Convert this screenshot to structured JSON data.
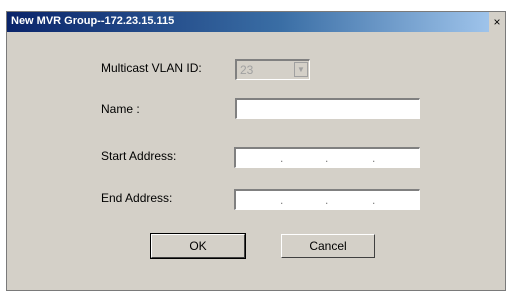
{
  "window": {
    "title": "New MVR Group--172.23.15.115",
    "close_glyph": "×"
  },
  "form": {
    "vlan_label": "Multicast VLAN ID:",
    "vlan_value": "23",
    "name_label": "Name :",
    "name_value": "",
    "start_label": "Start Address:",
    "end_label": "End Address:",
    "ip_dot": "."
  },
  "buttons": {
    "ok": "OK",
    "cancel": "Cancel"
  },
  "icons": {
    "dropdown": "chevron-down-icon",
    "close": "close-icon"
  }
}
